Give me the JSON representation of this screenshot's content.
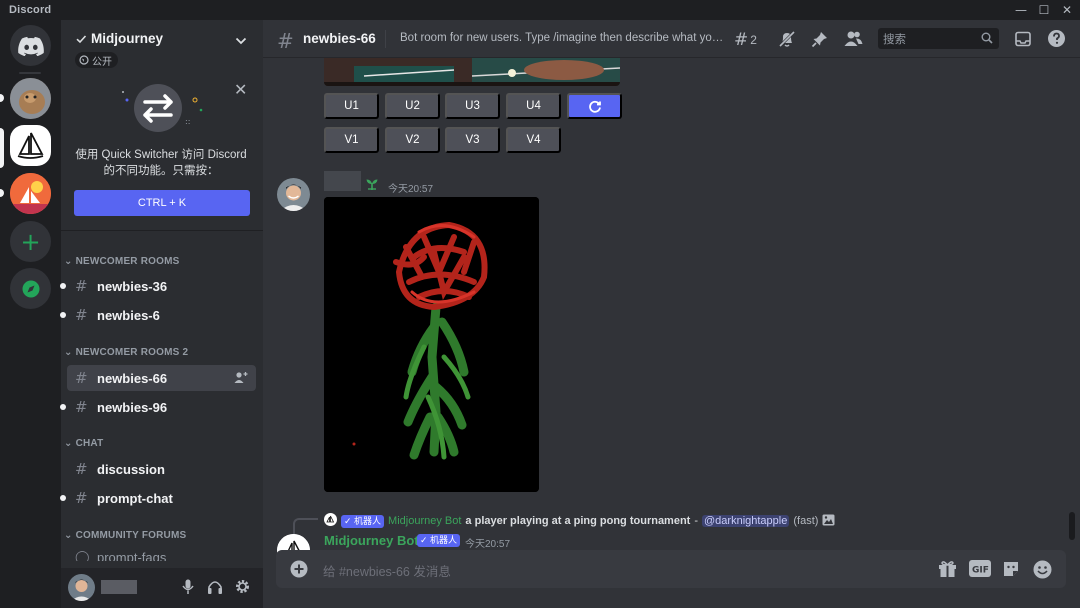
{
  "window": {
    "title": "Discord",
    "controls": [
      "—",
      "☐",
      "✕"
    ]
  },
  "guild": {
    "name": "Midjourney",
    "public_label": "公开"
  },
  "quick_switcher": {
    "text": "使用 Quick Switcher 访问 Discord 的不同功能。只需按：",
    "shortcut": "CTRL + K"
  },
  "sidebar": {
    "categories": [
      {
        "label": "NEWCOMER ROOMS",
        "channels": [
          "newbies-36",
          "newbies-6"
        ]
      },
      {
        "label": "NEWCOMER ROOMS 2",
        "channels": [
          "newbies-66",
          "newbies-96"
        ]
      },
      {
        "label": "CHAT",
        "channels": [
          "discussion",
          "prompt-chat"
        ]
      },
      {
        "label": "COMMUNITY FORUMS",
        "channels": [
          "prompt-faqs"
        ]
      }
    ],
    "active_channel": "newbies-66"
  },
  "topbar": {
    "channel": "newbies-66",
    "topic": "Bot room for new users. Type /imagine then describe what you...",
    "threads_count": "2",
    "search_placeholder": "搜索"
  },
  "messages": {
    "upscale_buttons": [
      "U1",
      "U2",
      "U3",
      "U4"
    ],
    "variation_buttons": [
      "V1",
      "V2",
      "V3",
      "V4"
    ],
    "user_message": {
      "time": "今天20:57",
      "attachment": "flower sketch"
    },
    "reply_preview": {
      "author": "Midjourney Bot",
      "bot_tag": "✓ 机器人",
      "prompt": "a player playing at a ping pong tournament",
      "separator": " - ",
      "mention": "@darknightapple",
      "speed": "(fast)"
    },
    "bot_message": {
      "author": "Midjourney Bot",
      "bot_tag": "✓ 机器人",
      "time": "今天20:57"
    }
  },
  "composer": {
    "placeholder": "给 #newbies-66 发消息"
  },
  "colors": {
    "blurple": "#5865f2",
    "green": "#3ba55c",
    "bg_main": "#313338",
    "bg_sidebar": "#2b2d31"
  }
}
